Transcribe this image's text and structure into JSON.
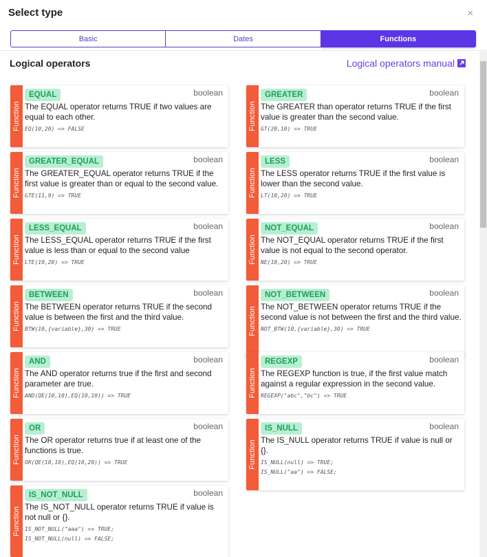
{
  "dialog": {
    "title": "Select type",
    "close_glyph": "×"
  },
  "tabs": [
    {
      "label": "Basic",
      "active": false
    },
    {
      "label": "Dates",
      "active": false
    },
    {
      "label": "Functions",
      "active": true
    }
  ],
  "section": {
    "title": "Logical operators",
    "manual_link": "Logical operators manual",
    "manual_icon": "external-link-icon"
  },
  "card_side_label": "Function",
  "accent_colors": {
    "primary": "#5b35e6",
    "card_side": "#f25c38",
    "badge_bg": "#b8efd2",
    "badge_text": "#1e9e5c"
  },
  "cards": [
    {
      "name": "EQUAL",
      "type": "boolean",
      "description": "The EQUAL operator returns TRUE if two values are equal to each other.",
      "examples": [
        "EQ(10,20) => FALSE"
      ]
    },
    {
      "name": "GREATER",
      "type": "boolean",
      "description": "The GREATER than operator returns TRUE if the first value is greater than the second value.",
      "examples": [
        "GT(20,10) => TRUE"
      ]
    },
    {
      "name": "GREATER_EQUAL",
      "type": "boolean",
      "description": "The GREATER_EQUAL operator returns TRUE if the first value is greater than or equal to the second value.",
      "examples": [
        "GTE(11,9) => TRUE"
      ]
    },
    {
      "name": "LESS",
      "type": "boolean",
      "description": "The LESS operator returns TRUE if the first value is lower than the second value.",
      "examples": [
        "LT(10,20) => TRUE"
      ]
    },
    {
      "name": "LESS_EQUAL",
      "type": "boolean",
      "description": "The LESS_EQUAL operator returns TRUE if the first value is less than or equal to the second value",
      "examples": [
        "LTE(10,20) => TRUE"
      ]
    },
    {
      "name": "NOT_EQUAL",
      "type": "boolean",
      "description": "The NOT_EQUAL operator returns TRUE if the first value is not equal to the second operator.",
      "examples": [
        "NE(10,20) => TRUE"
      ]
    },
    {
      "name": "BETWEEN",
      "type": "boolean",
      "description": "The BETWEEN operator returns TRUE if the second value is between the first and the third value.",
      "examples": [
        "BTW(10,{variable},30) => TRUE"
      ]
    },
    {
      "name": "NOT_BETWEEN",
      "type": "boolean",
      "description": "The NOT_BETWEEN operator returns TRUE if the second value is not between the first and the third value.",
      "examples": [
        "NOT_BTW(10,{variable},30) => TRUE"
      ]
    },
    {
      "name": "AND",
      "type": "boolean",
      "description": "The AND operator returns true if the first and second parameter are true.",
      "examples": [
        "AND(QE(10,10),EQ(10,10)) => TRUE"
      ]
    },
    {
      "name": "REGEXP",
      "type": "boolean",
      "description": "The REGEXP function is true, if the first value match against a regular expression in the second value.",
      "examples": [
        "REGEXP(\"abc\",\"bc\") => TRUE"
      ]
    },
    {
      "name": "OR",
      "type": "boolean",
      "description": "The OR operator returns true if at least one of the functions is true.",
      "examples": [
        "OR(QE(10,10),EQ(10,20)) => TRUE"
      ]
    },
    {
      "name": "IS_NULL",
      "type": "boolean",
      "description": "The IS_NULL operator returns TRUE if value is null or {}.",
      "examples": [
        "IS_NULL(null) => TRUE;",
        "IS_NULL(\"aa\") => FALSE;"
      ]
    },
    {
      "name": "IS_NOT_NULL",
      "type": "boolean",
      "description": "The IS_NOT_NULL operator returns TRUE if value is not null or {}.",
      "examples": [
        "IS_NOT_NULL(\"aaa\") => TRUE;",
        "IS_NOT_NULL(null) => FALSE;"
      ]
    }
  ]
}
